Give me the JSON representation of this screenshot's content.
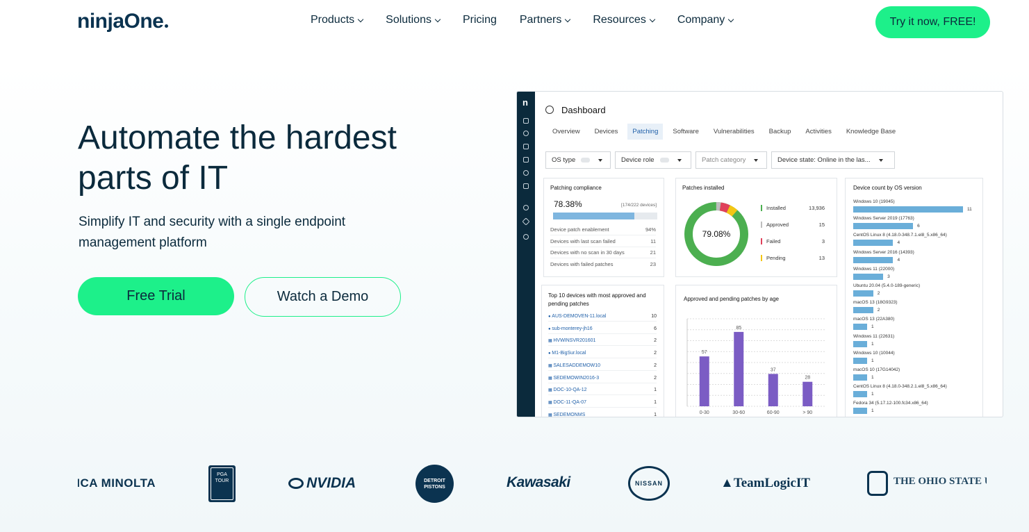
{
  "nav": {
    "logo": "ninjaOne",
    "menu": [
      {
        "label": "Products",
        "has_dropdown": true
      },
      {
        "label": "Solutions",
        "has_dropdown": true
      },
      {
        "label": "Pricing",
        "has_dropdown": false
      },
      {
        "label": "Partners",
        "has_dropdown": true
      },
      {
        "label": "Resources",
        "has_dropdown": true
      },
      {
        "label": "Company",
        "has_dropdown": true
      }
    ],
    "cta": "Try it now, FREE!"
  },
  "hero": {
    "title": "Automate the hardest parts of IT",
    "subtitle": "Simplify IT and security with a single endpoint management platform",
    "primary_button": "Free Trial",
    "secondary_button": "Watch a Demo"
  },
  "dashboard": {
    "sidebar_logo": "n",
    "title": "Dashboard",
    "tabs": [
      "Overview",
      "Devices",
      "Patching",
      "Software",
      "Vulnerabilities",
      "Backup",
      "Activities",
      "Knowledge Base"
    ],
    "active_tab": "Patching",
    "filters": [
      "OS type",
      "Device role",
      "Patch category",
      "Device state: Online in the las..."
    ],
    "compliance": {
      "title": "Patching compliance",
      "percent": "78.38%",
      "detail": "[174/222 devices]",
      "fill_fraction": 0.78,
      "rows": [
        {
          "label": "Device patch enablement",
          "value": "94%"
        },
        {
          "label": "Devices with last scan failed",
          "value": "11"
        },
        {
          "label": "Devices with no scan in 30 days",
          "value": "21"
        },
        {
          "label": "Devices with failed patches",
          "value": "23"
        }
      ]
    },
    "installed": {
      "title": "Patches installed",
      "center": "79.08%",
      "legend": [
        {
          "label": "Installed",
          "value": "13,936",
          "color": "#4caf50"
        },
        {
          "label": "Approved",
          "value": "15",
          "color": "#bdbdbd"
        },
        {
          "label": "Failed",
          "value": "3",
          "color": "#e0415b"
        },
        {
          "label": "Pending",
          "value": "13",
          "color": "#f3c614"
        }
      ]
    },
    "os_versions": {
      "title": "Device count by OS version",
      "items": [
        {
          "label": "Windows 10 (19045)",
          "value": "11",
          "n": 11
        },
        {
          "label": "Windows Server 2019 (17763)",
          "value": "6",
          "n": 6
        },
        {
          "label": "CentOS Linux 8 (4.18.0-348.7.1.el8_5.x86_64)",
          "value": "4",
          "n": 4
        },
        {
          "label": "Windows Server 2016 (14393)",
          "value": "4",
          "n": 4
        },
        {
          "label": "Windows 11 (22000)",
          "value": "3",
          "n": 3
        },
        {
          "label": "Ubuntu 20.04 (5.4.0-189-generic)",
          "value": "2",
          "n": 2
        },
        {
          "label": "macOS 13 (18G9323)",
          "value": "2",
          "n": 2
        },
        {
          "label": "macOS 13 (22A380)",
          "value": "1",
          "n": 1
        },
        {
          "label": "Windows 11 (22631)",
          "value": "1",
          "n": 1
        },
        {
          "label": "Windows 10 (10044)",
          "value": "1",
          "n": 1
        },
        {
          "label": "macOS 10 (17G14042)",
          "value": "1",
          "n": 1
        },
        {
          "label": "CentOS Linux 8 (4.18.0-348.2.1.el8_5.x86_64)",
          "value": "1",
          "n": 1
        },
        {
          "label": "Fedora 34 (5.17.12-100.fc34.x86_64)",
          "value": "1",
          "n": 1
        }
      ]
    },
    "top_devices": {
      "title": "Top 10 devices with most approved and pending patches",
      "items": [
        {
          "name": "AUS-DEMOVEN-11.local",
          "count": "10",
          "os": "apple"
        },
        {
          "name": "sub-monterey-jh16",
          "count": "6",
          "os": "apple"
        },
        {
          "name": "HVWINSVR201601",
          "count": "2",
          "os": "windows"
        },
        {
          "name": "M1-BigSur.local",
          "count": "2",
          "os": "apple"
        },
        {
          "name": "SALESADDEMOW10",
          "count": "2",
          "os": "windows"
        },
        {
          "name": "SEDEMOWIN2016-3",
          "count": "2",
          "os": "windows"
        },
        {
          "name": "DOC-10-QA-12",
          "count": "1",
          "os": "windows"
        },
        {
          "name": "DOC-11-QA-07",
          "count": "1",
          "os": "windows"
        },
        {
          "name": "SEDEMONMS",
          "count": "1",
          "os": "windows"
        }
      ]
    },
    "by_age": {
      "title": "Approved and pending patches by age",
      "chart_data": {
        "type": "bar",
        "categories": [
          "0-30",
          "30-60",
          "60-90",
          "> 90"
        ],
        "values": [
          57,
          85,
          37,
          28
        ],
        "ylim": [
          0,
          100
        ],
        "color": "#7b5cc4"
      }
    }
  },
  "logos": [
    "KONICA MINOLTA",
    "PGA TOUR",
    "NVIDIA",
    "DETROIT PISTONS",
    "Kawasaki",
    "NISSAN",
    "TeamLogicIT",
    "THE OHIO STATE UNIVERSITY"
  ]
}
